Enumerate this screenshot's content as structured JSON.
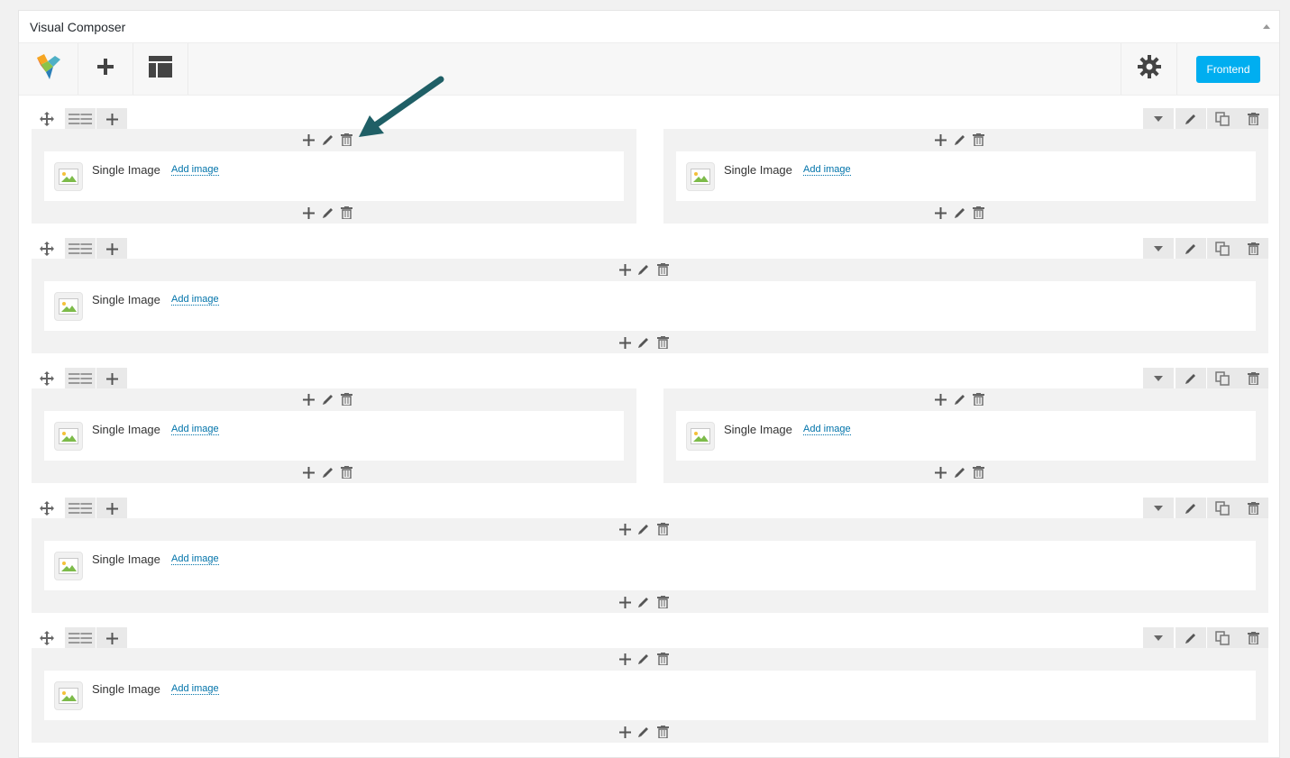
{
  "panel": {
    "title": "Visual Composer"
  },
  "navbar": {
    "logo_icon": "vc-logo-icon",
    "add_icon": "plus-icon",
    "templates_icon": "layout-icon",
    "settings_icon": "gear-icon",
    "frontend_label": "Frontend"
  },
  "colors": {
    "accent": "#00aef0",
    "link": "#0073aa",
    "arrow": "#1f5f66"
  },
  "rows": [
    {
      "columns": [
        {
          "element": {
            "title": "Single Image",
            "link": "Add image"
          }
        },
        {
          "element": {
            "title": "Single Image",
            "link": "Add image"
          }
        }
      ]
    },
    {
      "columns": [
        {
          "element": {
            "title": "Single Image",
            "link": "Add image"
          }
        }
      ]
    },
    {
      "columns": [
        {
          "element": {
            "title": "Single Image",
            "link": "Add image"
          }
        },
        {
          "element": {
            "title": "Single Image",
            "link": "Add image"
          }
        }
      ]
    },
    {
      "columns": [
        {
          "element": {
            "title": "Single Image",
            "link": "Add image"
          }
        }
      ]
    },
    {
      "columns": [
        {
          "element": {
            "title": "Single Image",
            "link": "Add image"
          }
        }
      ]
    }
  ]
}
